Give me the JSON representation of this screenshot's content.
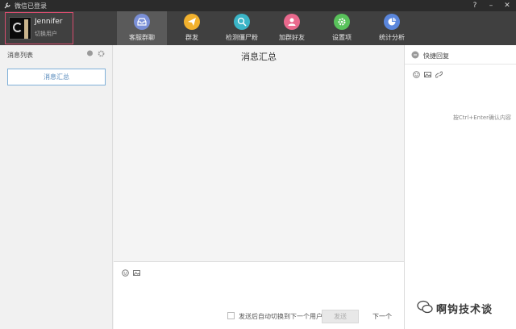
{
  "window": {
    "title": "微信已登录",
    "help_glyph": "?",
    "minimize_glyph": "–",
    "close_glyph": "✕"
  },
  "account": {
    "name": "Jennifer",
    "switch_label": "切换用户"
  },
  "nav": [
    {
      "label": "客服群聊",
      "color": "#7a8fd6",
      "icon": "inbox-icon",
      "active": true
    },
    {
      "label": "群发",
      "color": "#f1b12e",
      "icon": "paper-plane-icon",
      "active": false
    },
    {
      "label": "检测僵尸粉",
      "color": "#3bb5c7",
      "icon": "search-user-icon",
      "active": false
    },
    {
      "label": "加群好友",
      "color": "#e9698d",
      "icon": "add-user-icon",
      "active": false
    },
    {
      "label": "设置项",
      "color": "#59c25b",
      "icon": "gear-icon",
      "active": false
    },
    {
      "label": "统计分析",
      "color": "#5a86dc",
      "icon": "pie-chart-icon",
      "active": false
    }
  ],
  "left_panel": {
    "title": "消息列表",
    "summary_button": "消息汇总"
  },
  "center": {
    "title": "消息汇总",
    "auto_switch_label": "发送后自动切换到下一个用户",
    "send_label": "发送",
    "next_label": "下一个"
  },
  "right_panel": {
    "title": "快捷回复",
    "hint": "按Ctrl+Enter确认内容"
  },
  "watermark": {
    "text": "啊钩技术谈"
  },
  "colors": {
    "header_bg": "#404040",
    "account_border": "#d64d6e",
    "summary_border": "#7fb0d8"
  }
}
